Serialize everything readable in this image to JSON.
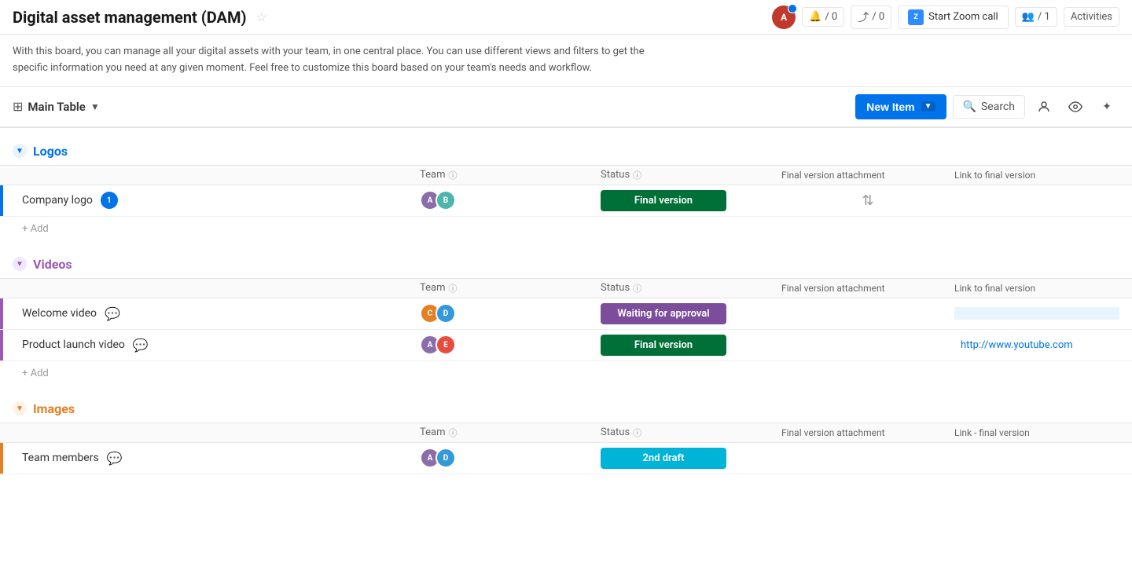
{
  "header": {
    "title": "Digital asset management (DAM)",
    "description": "With this board, you can manage all your digital assets with your team, in one central place. You can use different views and filters to get the specific information you need at any given moment. Feel free to customize this board based on your team's needs and workflow.",
    "star_icon": "☆",
    "notifications_count": "/ 0",
    "updates_count": "/ 0",
    "zoom_label": "Start Zoom call",
    "people_count": "/ 1",
    "activities_label": "Activities"
  },
  "toolbar": {
    "main_table_label": "Main Table",
    "new_item_label": "New Item",
    "search_label": "Search"
  },
  "sections": [
    {
      "id": "logos",
      "title": "Logos",
      "color_class": "logos",
      "columns": {
        "team": "Team",
        "status": "Status",
        "attachment": "Final version attachment",
        "link": "Link to final version"
      },
      "rows": [
        {
          "name": "Company logo",
          "has_update": true,
          "update_count": "1",
          "team": [
            "av1",
            "av2"
          ],
          "status": "Final version",
          "status_class": "status-final",
          "attachment": "📎",
          "link": ""
        }
      ],
      "add_label": "+ Add"
    },
    {
      "id": "videos",
      "title": "Videos",
      "color_class": "videos",
      "columns": {
        "team": "Team",
        "status": "Status",
        "attachment": "Final version attachment",
        "link": "Link to final version"
      },
      "rows": [
        {
          "name": "Welcome video",
          "has_comment": true,
          "team": [
            "av3",
            "av4"
          ],
          "status": "Waiting for approval",
          "status_class": "status-waiting",
          "attachment": "",
          "link": ""
        },
        {
          "name": "Product launch video",
          "has_comment": true,
          "team": [
            "av1",
            "av5"
          ],
          "status": "Final version",
          "status_class": "status-final",
          "attachment": "",
          "link": "http://www.youtube.com"
        }
      ],
      "add_label": "+ Add"
    },
    {
      "id": "images",
      "title": "Images",
      "color_class": "images",
      "columns": {
        "team": "Team",
        "status": "Status",
        "attachment": "Final version attachment",
        "link": "Link - final version"
      },
      "rows": [
        {
          "name": "Team members",
          "has_comment": true,
          "team": [
            "av1",
            "av4"
          ],
          "status": "2nd draft",
          "status_class": "status-draft",
          "attachment": "",
          "link": ""
        }
      ],
      "add_label": "+ Add"
    }
  ]
}
